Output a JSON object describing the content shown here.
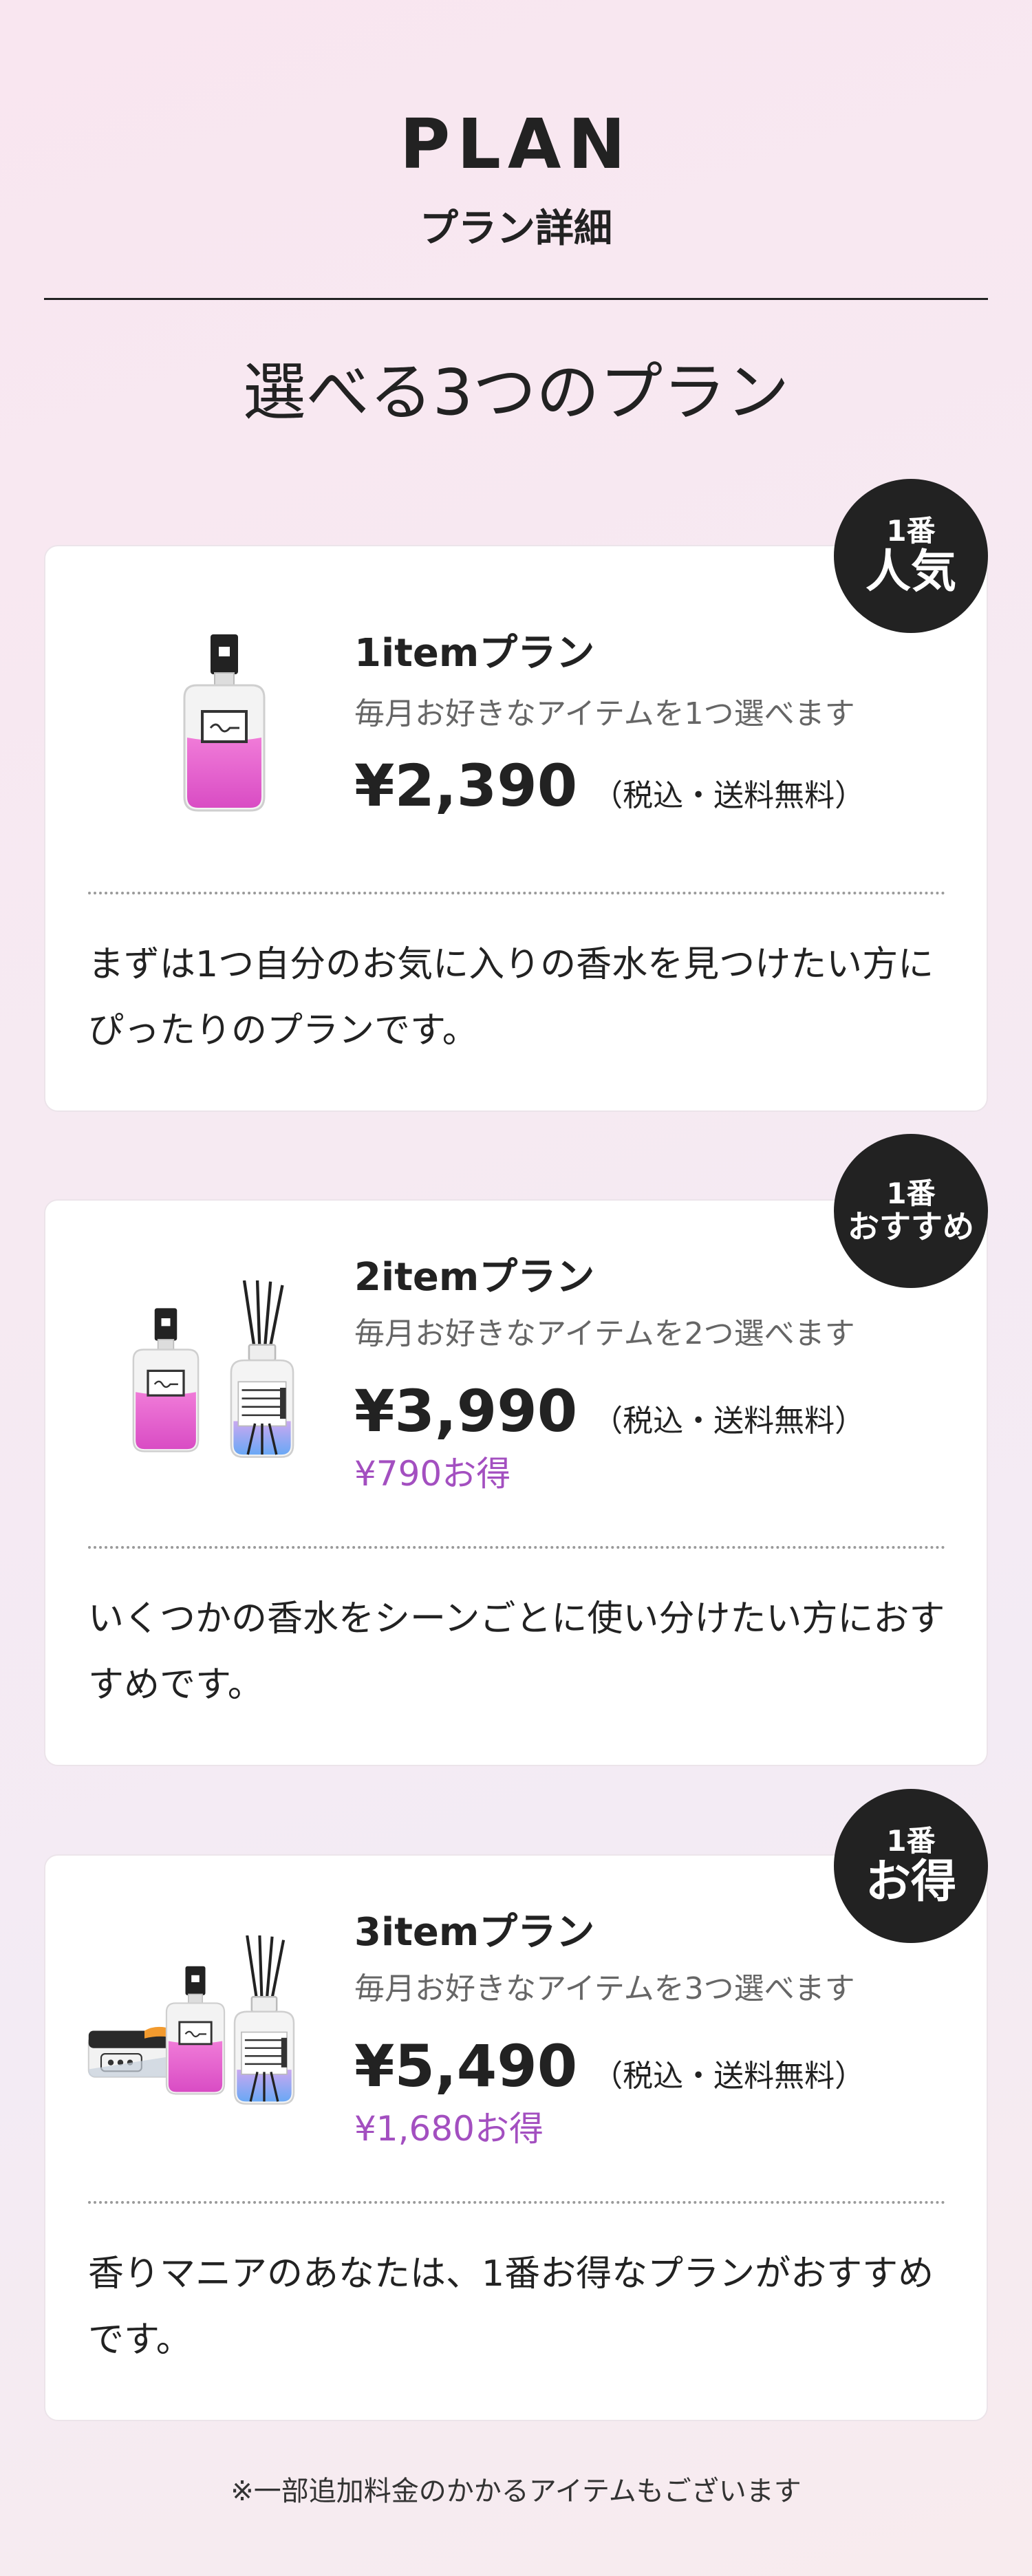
{
  "header": {
    "title": "PLAN",
    "subtitle": "プラン詳細"
  },
  "section_heading": "選べる3つのプラン",
  "plans": [
    {
      "badge_rank": "1番",
      "badge_label": "人気",
      "name": "1itemプラン",
      "description": "毎月お好きなアイテムを1つ選べます",
      "price": "¥2,390",
      "tax_note": "（税込・送料無料）",
      "saving": "",
      "body": "まずは1つ自分のお気に入りの香水を見つけたい方にぴったりのプランです。",
      "illustration": "perfume-bottle-icon"
    },
    {
      "badge_rank": "1番",
      "badge_label": "おすすめ",
      "name": "2itemプラン",
      "description": "毎月お好きなアイテムを2つ選べます",
      "price": "¥3,990",
      "tax_note": "（税込・送料無料）",
      "saving": "¥790お得",
      "body": "いくつかの香水をシーンごとに使い分けたい方におすすめです。",
      "illustration": "perfume-and-diffuser-icon"
    },
    {
      "badge_rank": "1番",
      "badge_label": "お得",
      "name": "3itemプラン",
      "description": "毎月お好きなアイテムを3つ選べます",
      "price": "¥5,490",
      "tax_note": "（税込・送料無料）",
      "saving": "¥1,680お得",
      "body": "香りマニアのあなたは、1番お得なプランがおすすめです。",
      "illustration": "cream-perfume-diffuser-icon"
    }
  ],
  "footnote": "※一部追加料金のかかるアイテムもございます",
  "colors": {
    "accent_purple": "#a34fc0",
    "badge_bg": "#222222",
    "perfume_pink": "#e35fd0",
    "diffuser_blue": "#7aa6f2"
  }
}
